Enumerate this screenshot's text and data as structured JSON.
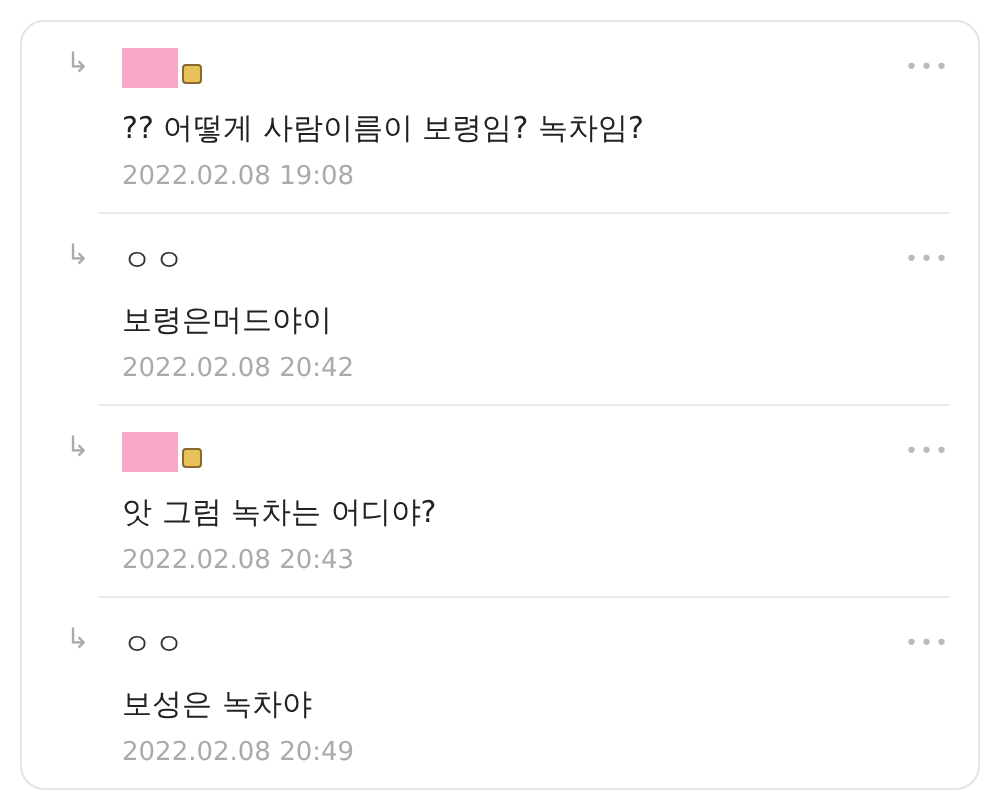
{
  "replies": [
    {
      "reply_mark": "↳",
      "author": {
        "kind": "redacted",
        "badge": true
      },
      "more": "•••",
      "text": "?? 어떻게 사람이름이 보령임? 녹차임?",
      "time": "2022.02.08 19:08"
    },
    {
      "reply_mark": "↳",
      "author": {
        "kind": "name",
        "name": "ㅇㅇ",
        "badge": false
      },
      "more": "•••",
      "text": "보령은머드야이",
      "time": "2022.02.08 20:42"
    },
    {
      "reply_mark": "↳",
      "author": {
        "kind": "redacted",
        "badge": true
      },
      "more": "•••",
      "text": "앗 그럼 녹차는 어디야?",
      "time": "2022.02.08 20:43"
    },
    {
      "reply_mark": "↳",
      "author": {
        "kind": "name",
        "name": "ㅇㅇ",
        "badge": false
      },
      "more": "•••",
      "text": "보성은 녹차야",
      "time": "2022.02.08 20:49"
    }
  ]
}
